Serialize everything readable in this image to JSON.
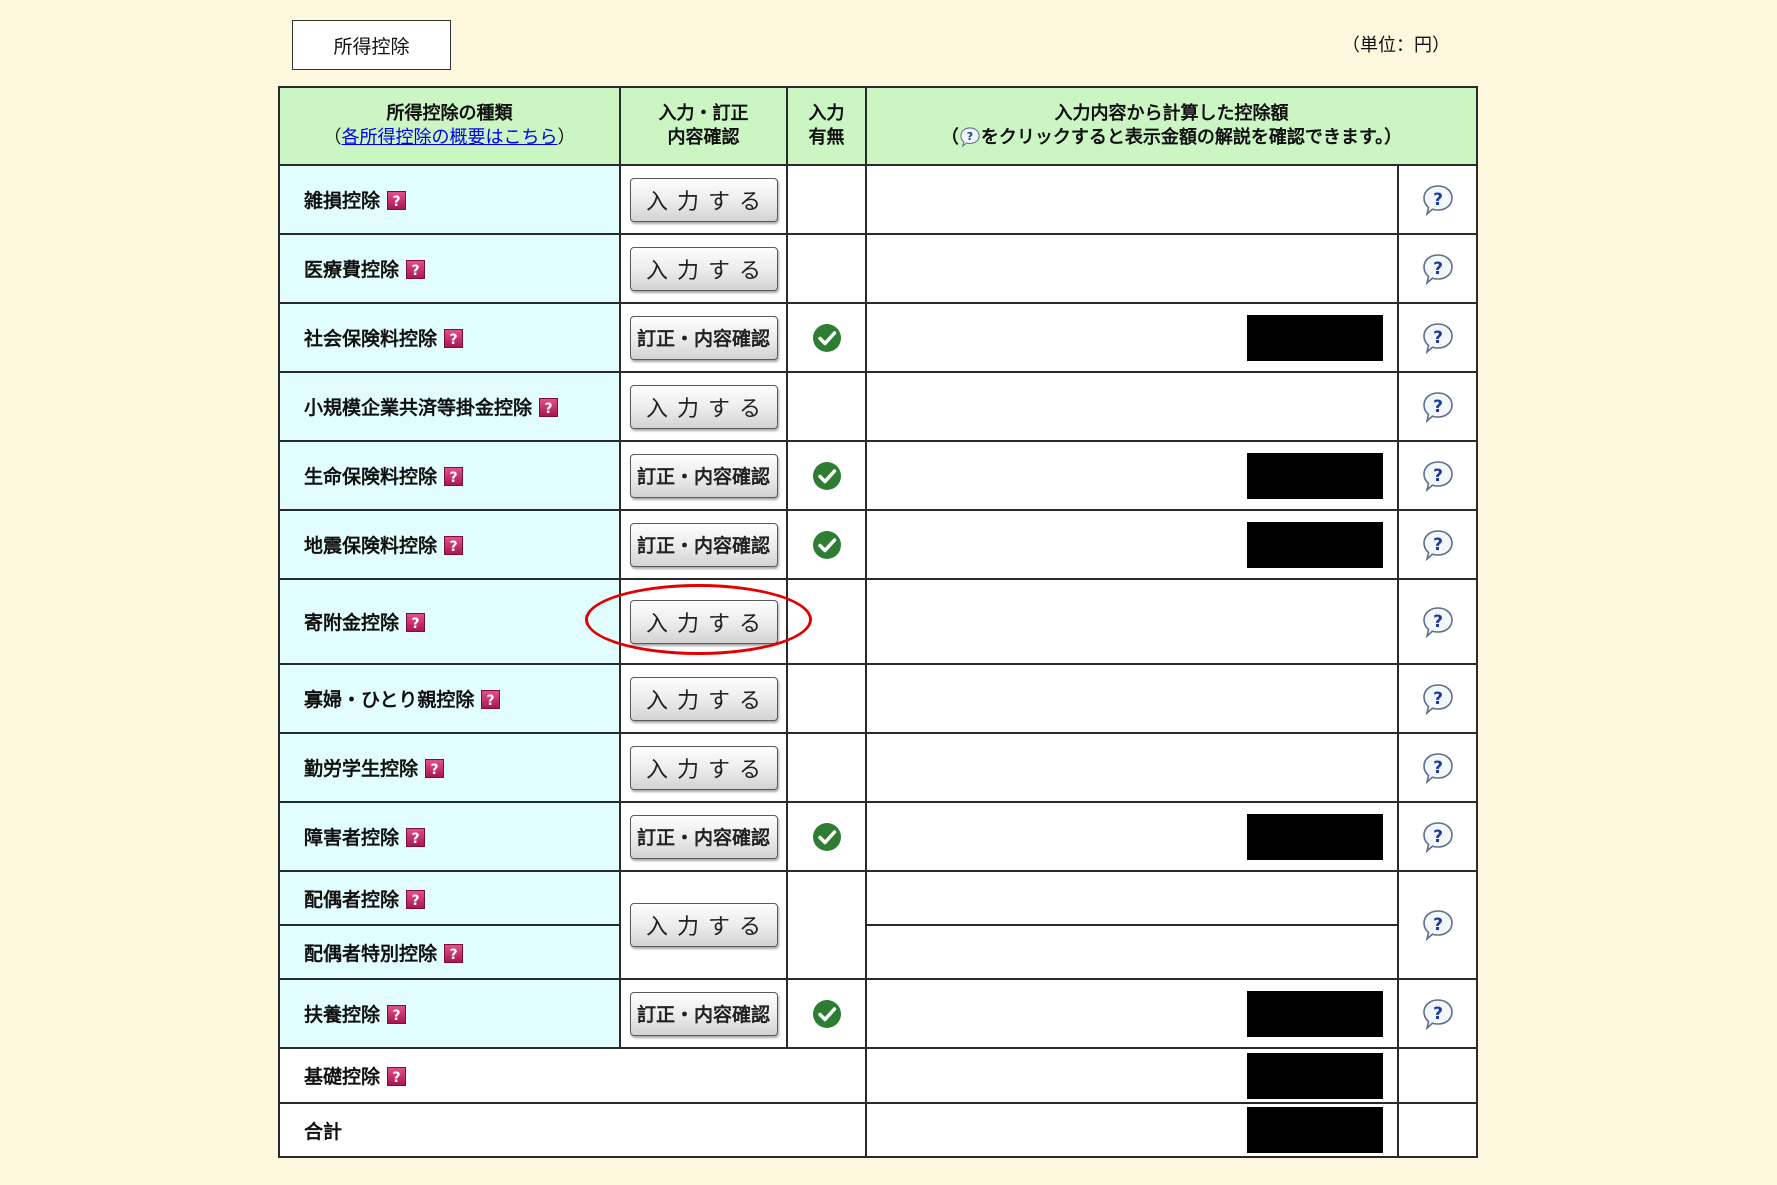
{
  "tab_label": "所得控除",
  "unit_label": "（単位：円）",
  "colors": {
    "page_bg": "#fdf7dd",
    "header_bg": "#ccf5c4",
    "label_bg": "#e1fdfd",
    "link": "#0000ee",
    "check": "#2e7d32",
    "help_icon": "#c72c6b",
    "highlight_ellipse": "#e30000"
  },
  "icons": {
    "help": "help-icon",
    "explanation": "question-bubble-icon",
    "entered": "check-icon"
  },
  "header": {
    "type_title": "所得控除の種類",
    "type_paren_open": "（",
    "type_link": "各所得控除の概要はこちら",
    "type_paren_close": "）",
    "input_line1": "入力・訂正",
    "input_line2": "内容確認",
    "status_line1": "入力",
    "status_line2": "有無",
    "amount_line1": "入力内容から計算した控除額",
    "amount_paren_open": "（",
    "amount_line2": "をクリックすると表示金額の解説を確認できます。）"
  },
  "rows": [
    {
      "label": "雑損控除",
      "button": "入力する",
      "entered": false,
      "amount_redacted": false
    },
    {
      "label": "医療費控除",
      "button": "入力する",
      "entered": false,
      "amount_redacted": false
    },
    {
      "label": "社会保険料控除",
      "button": "訂正・内容確認",
      "entered": true,
      "amount_redacted": true
    },
    {
      "label": "小規模企業共済等掛金控除",
      "button": "入力する",
      "entered": false,
      "amount_redacted": false
    },
    {
      "label": "生命保険料控除",
      "button": "訂正・内容確認",
      "entered": true,
      "amount_redacted": true
    },
    {
      "label": "地震保険料控除",
      "button": "訂正・内容確認",
      "entered": true,
      "amount_redacted": true
    },
    {
      "label": "寄附金控除",
      "button": "入力する",
      "entered": false,
      "amount_redacted": false,
      "highlighted": true
    },
    {
      "label": "寡婦・ひとり親控除",
      "button": "入力する",
      "entered": false,
      "amount_redacted": false
    },
    {
      "label": "勤労学生控除",
      "button": "入力する",
      "entered": false,
      "amount_redacted": false
    },
    {
      "label": "障害者控除",
      "button": "訂正・内容確認",
      "entered": true,
      "amount_redacted": true
    },
    {
      "labels": [
        "配偶者控除",
        "配偶者特別控除"
      ],
      "button": "入力する",
      "entered": false,
      "amount_redacted": [
        false,
        false
      ]
    },
    {
      "label": "扶養控除",
      "button": "訂正・内容確認",
      "entered": true,
      "amount_redacted": true
    }
  ],
  "summary_rows": [
    {
      "label": "基礎控除",
      "amount_redacted": true
    },
    {
      "label": "合計",
      "amount_redacted": true
    }
  ]
}
